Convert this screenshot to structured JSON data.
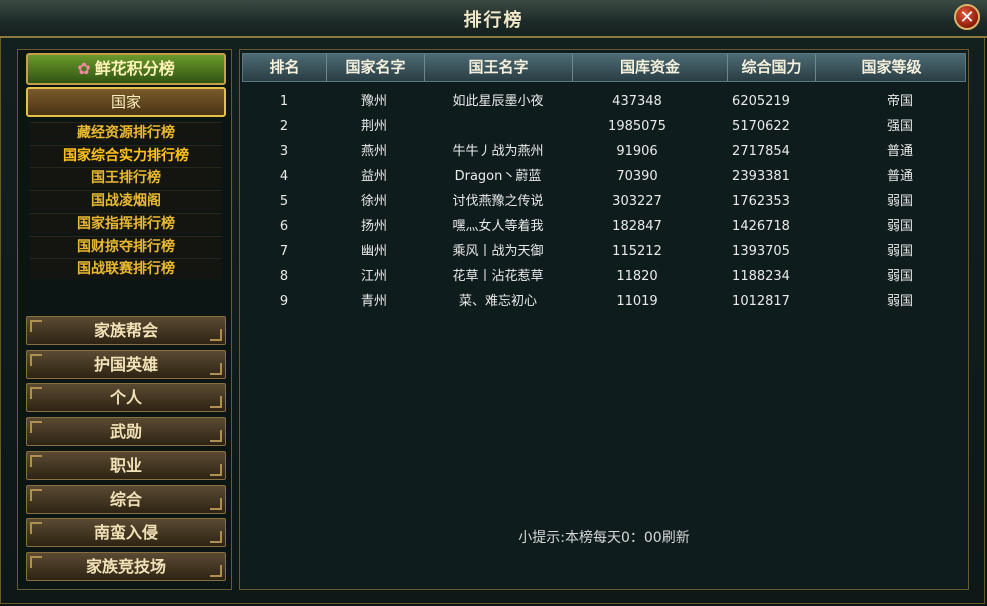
{
  "window": {
    "title": "排行榜",
    "close_icon": "close-icon"
  },
  "left": {
    "flower_button": "鲜花积分榜",
    "country_button": "国家",
    "sub_items": [
      "藏经资源排行榜",
      "国家综合实力排行榜",
      "国王排行榜",
      "国战凌烟阁",
      "国家指挥排行榜",
      "国财掠夺排行榜",
      "国战联赛排行榜"
    ],
    "active_index": 1,
    "buttons": [
      "家族帮会",
      "护国英雄",
      "个人",
      "武勋",
      "职业",
      "综合",
      "南蛮入侵",
      "家族竞技场"
    ]
  },
  "table": {
    "headers": [
      "排名",
      "国家名字",
      "国王名字",
      "国库资金",
      "综合国力",
      "国家等级"
    ],
    "rows": [
      [
        "1",
        "豫州",
        "如此星辰墨小夜",
        "437348",
        "6205219",
        "帝国"
      ],
      [
        "2",
        "荆州",
        "",
        "1985075",
        "5170622",
        "强国"
      ],
      [
        "3",
        "燕州",
        "牛牛丿战为燕州",
        "91906",
        "2717854",
        "普通"
      ],
      [
        "4",
        "益州",
        "Dragon丶蔚蓝",
        "70390",
        "2393381",
        "普通"
      ],
      [
        "5",
        "徐州",
        "讨伐燕豫之传说",
        "303227",
        "1762353",
        "弱国"
      ],
      [
        "6",
        "扬州",
        "嘿灬女人等着我",
        "182847",
        "1426718",
        "弱国"
      ],
      [
        "7",
        "幽州",
        "乘风丨战为天御",
        "115212",
        "1393705",
        "弱国"
      ],
      [
        "8",
        "江州",
        "花草丨沾花惹草",
        "11820",
        "1188234",
        "弱国"
      ],
      [
        "9",
        "青州",
        "菜、难忘初心",
        "11019",
        "1012817",
        "弱国"
      ]
    ]
  },
  "tip": "小提示:本榜每天0：00刷新"
}
